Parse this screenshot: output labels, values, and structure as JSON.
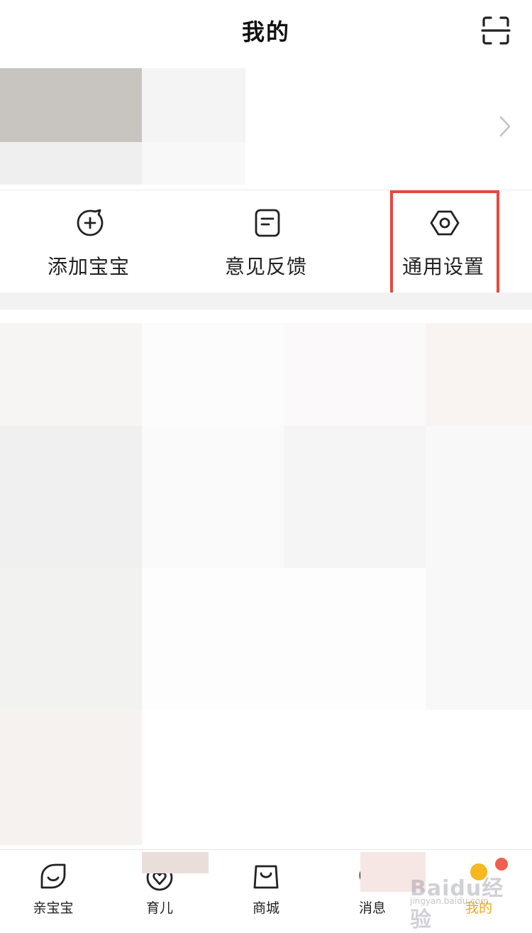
{
  "header": {
    "title": "我的",
    "scan_icon": "scan-icon"
  },
  "profile": {
    "chevron_icon": "chevron-right-icon"
  },
  "actions": [
    {
      "label": "添加宝宝",
      "icon": "add-baby-icon"
    },
    {
      "label": "意见反馈",
      "icon": "feedback-icon"
    },
    {
      "label": "通用设置",
      "icon": "settings-icon"
    }
  ],
  "highlight_color": "#e8473f",
  "tabbar": {
    "tabs": [
      {
        "label": "亲宝宝",
        "icon": "leaf-icon"
      },
      {
        "label": "育儿",
        "icon": "heart-icon"
      },
      {
        "label": "商城",
        "icon": "shopping-bag-icon"
      },
      {
        "label": "消息",
        "icon": "message-icon"
      },
      {
        "label": "我的",
        "icon": "me-icon"
      }
    ],
    "active_color": "#f5a623",
    "badge_color": "#f0604d"
  },
  "watermark": {
    "text": "Baidu经验",
    "sub": "jingyan.baidu.com"
  }
}
